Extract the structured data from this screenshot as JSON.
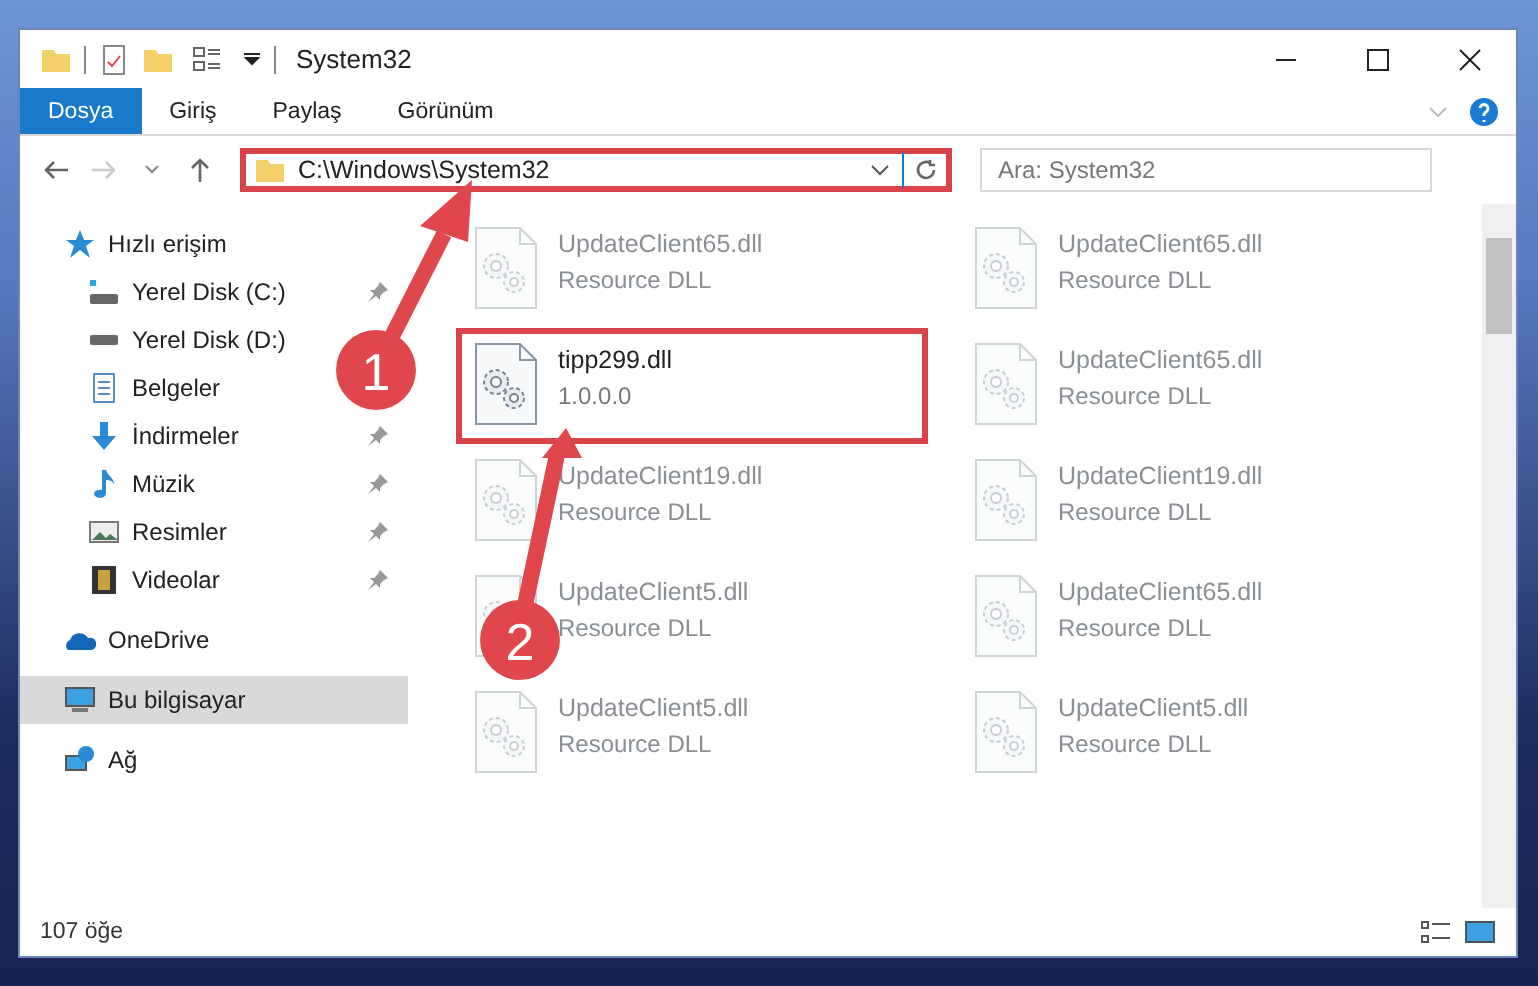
{
  "window": {
    "title": "System32"
  },
  "ribbon_tabs": [
    {
      "label": "Dosya",
      "selected": true
    },
    {
      "label": "Giriş",
      "selected": false
    },
    {
      "label": "Paylaş",
      "selected": false
    },
    {
      "label": "Görünüm",
      "selected": false
    }
  ],
  "address": {
    "path": "C:\\Windows\\System32",
    "highlighted": true
  },
  "search": {
    "placeholder": "Ara: System32"
  },
  "sidebar": {
    "items": [
      {
        "label": "Hızlı erişim",
        "selected": false,
        "children": [
          {
            "label": "Yerel Disk (C:)",
            "pinned": true
          },
          {
            "label": "Yerel Disk (D:)",
            "pinned": false
          },
          {
            "label": "Belgeler",
            "pinned": false
          },
          {
            "label": "İndirmeler",
            "pinned": true
          },
          {
            "label": "Müzik",
            "pinned": true
          },
          {
            "label": "Resimler",
            "pinned": true
          },
          {
            "label": "Videolar",
            "pinned": true
          }
        ]
      },
      {
        "label": "OneDrive",
        "selected": false
      },
      {
        "label": "Bu bilgisayar",
        "selected": true
      },
      {
        "label": "Ağ",
        "selected": false
      }
    ]
  },
  "files": [
    {
      "name": "UpdateClient65.dll",
      "detail": "Resource DLL",
      "faded": true,
      "highlighted": false
    },
    {
      "name": "UpdateClient65.dll",
      "detail": "Resource DLL",
      "faded": true,
      "highlighted": false
    },
    {
      "name": "tipp299.dll",
      "detail": "1.0.0.0",
      "faded": false,
      "highlighted": true
    },
    {
      "name": "UpdateClient65.dll",
      "detail": "Resource DLL",
      "faded": true,
      "highlighted": false
    },
    {
      "name": "UpdateClient19.dll",
      "detail": "Resource DLL",
      "faded": true,
      "highlighted": false
    },
    {
      "name": "UpdateClient19.dll",
      "detail": "Resource DLL",
      "faded": true,
      "highlighted": false
    },
    {
      "name": "UpdateClient5.dll",
      "detail": "Resource DLL",
      "faded": true,
      "highlighted": false
    },
    {
      "name": "UpdateClient65.dll",
      "detail": "Resource DLL",
      "faded": true,
      "highlighted": false
    },
    {
      "name": "UpdateClient5.dll",
      "detail": "Resource DLL",
      "faded": true,
      "highlighted": false
    },
    {
      "name": "UpdateClient5.dll",
      "detail": "Resource DLL",
      "faded": true,
      "highlighted": false
    }
  ],
  "callouts": [
    {
      "label": "1"
    },
    {
      "label": "2"
    }
  ],
  "status_bar": {
    "count": "107 öğe"
  }
}
